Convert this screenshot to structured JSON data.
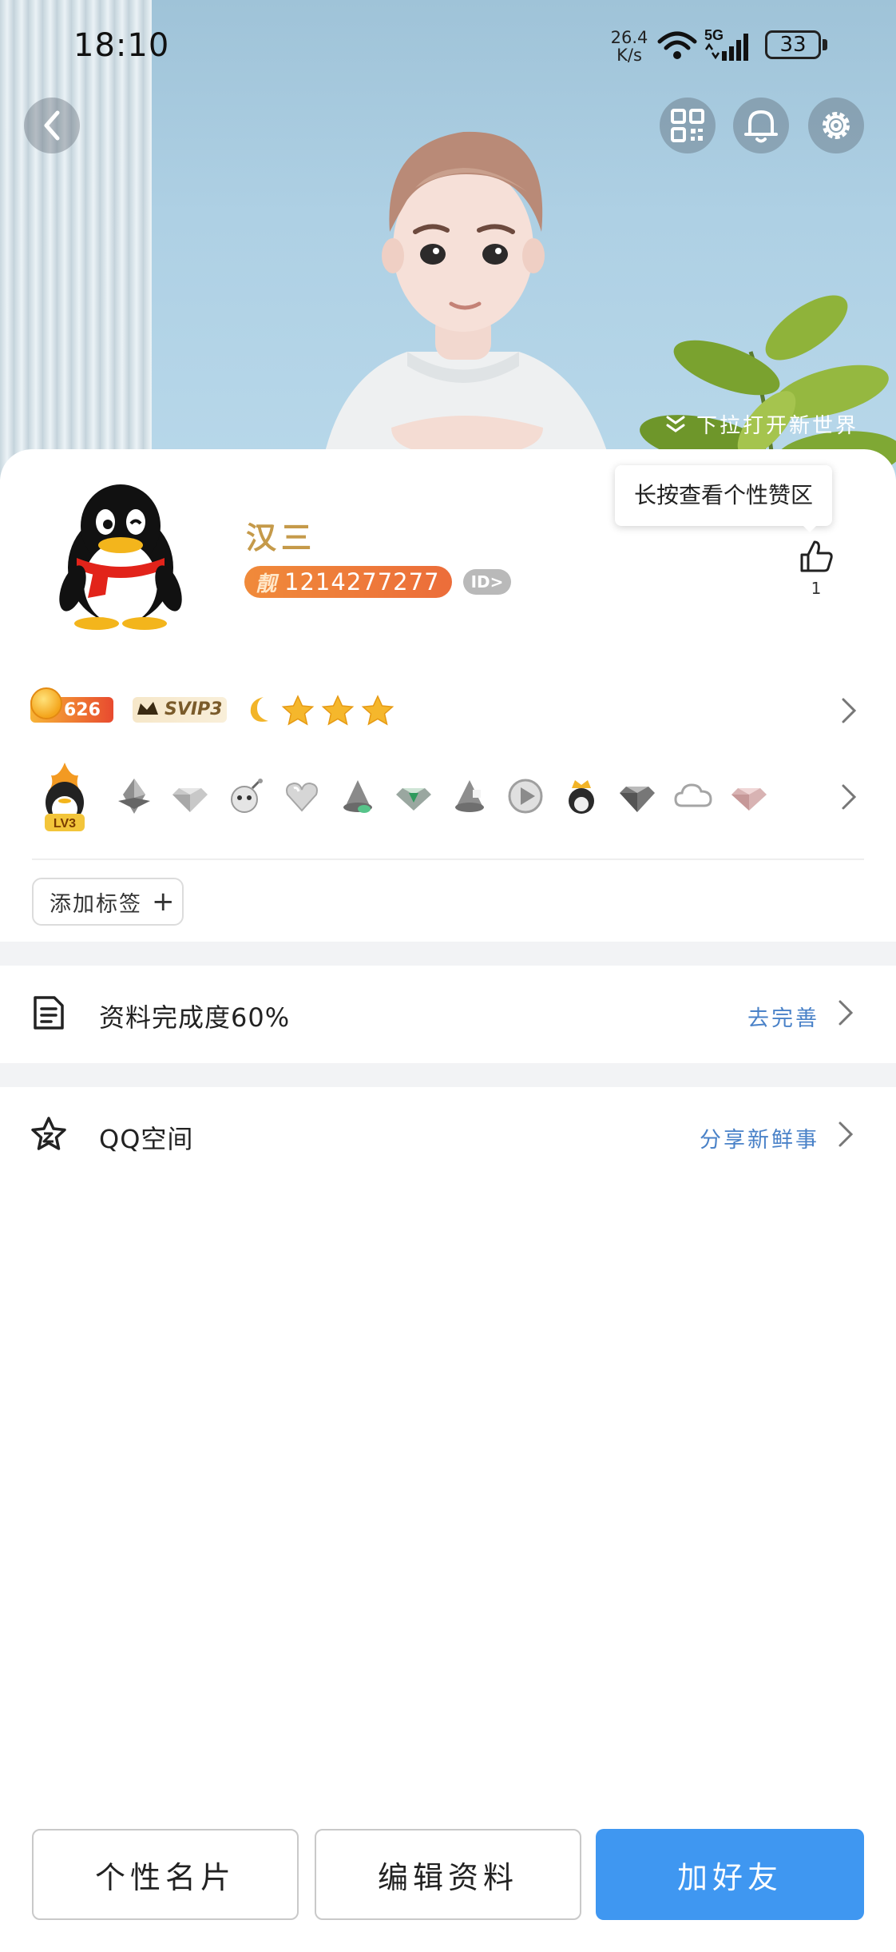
{
  "status_bar": {
    "time": "18:10",
    "net_speed_value": "26.4",
    "net_speed_unit": "K/s",
    "signal_label": "5G",
    "battery": "33"
  },
  "header": {
    "pull_hint": "下拉打开新世界"
  },
  "profile": {
    "nickname": "汉三",
    "liang_label": "靓",
    "qq_number": "1214277277",
    "id_badge": "ID>",
    "tooltip": "长按查看个性赞区",
    "like_count": "1"
  },
  "vip": {
    "coin_count": "626",
    "svip_label": "SVIP3",
    "star_count": 3
  },
  "badges": {
    "level_label": "LV3"
  },
  "tags": {
    "add_label": "添加标签",
    "plus": "+"
  },
  "list": {
    "profile_complete_label": "资料完成度60%",
    "profile_complete_action": "去完善",
    "qzone_label": "QQ空间",
    "qzone_action": "分享新鲜事"
  },
  "bottom": {
    "card_label": "个性名片",
    "edit_label": "编辑资料",
    "add_label": "加好友"
  },
  "colors": {
    "accent_blue": "#3f97f1",
    "link_blue": "#4a82c8",
    "nickname_gold": "#c59a4a",
    "qq_number_orange": "#ec6d3a"
  }
}
